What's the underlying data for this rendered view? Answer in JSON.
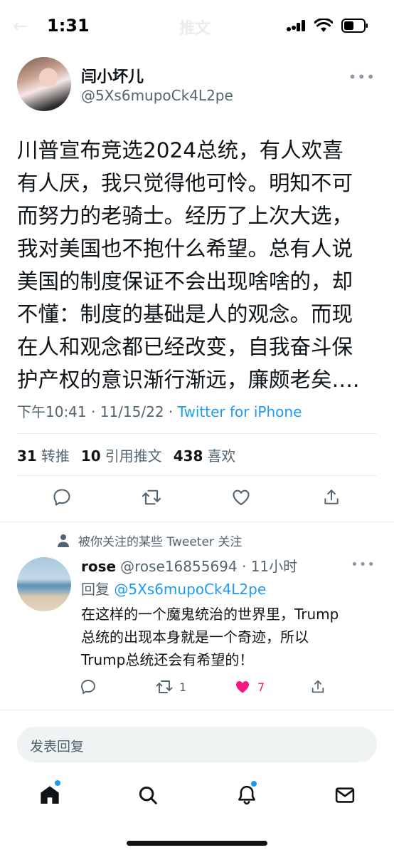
{
  "status_bar": {
    "time": "1:31"
  },
  "ghost_header": {
    "title": "推文"
  },
  "tweet": {
    "author_name": "闫小坏儿",
    "author_handle": "@5Xs6mupoCk4L2pe",
    "text": "川普宣布竞选2024总统，有人欢喜\n有人厌，我只觉得他可怜。明知不可\n而努力的老骑士。经历了上次大选，\n我对美国也不抱什么希望。总有人说\n美国的制度保证不会出现啥啥的，却\n不懂：制度的基础是人的观念。而现\n在人和观念都已经改变，自我奋斗保\n护产权的意识渐行渐远，廉颇老矣….",
    "time": "下午10:41",
    "date": "11/15/22",
    "separator": "·",
    "source": "Twitter for iPhone",
    "stats": {
      "retweets_count": "31",
      "retweets_label": "转推",
      "quotes_count": "10",
      "quotes_label": "引用推文",
      "likes_count": "438",
      "likes_label": "喜欢"
    }
  },
  "reply": {
    "context": "被你关注的某些 Tweeter 关注",
    "name": "rose",
    "handle": "@rose16855694",
    "separator": "·",
    "time": "11小时",
    "replying_label": "回复",
    "replying_to": "@5Xs6mupoCk4L2pe",
    "text": "在这样的一个魔鬼统治的世界里，Trump\n总统的出现本身就是一个奇迹，所以\nTrump总统还会有希望的！",
    "retweet_count": "1",
    "like_count": "7",
    "like_color": "#f91880"
  },
  "composer": {
    "placeholder": "发表回复"
  },
  "colors": {
    "accent": "#1d9bf0",
    "secondary_text": "#536471",
    "primary_text": "#0f1419"
  },
  "icons": [
    "home-icon",
    "search-icon",
    "bell-icon",
    "mail-icon",
    "reply-icon",
    "retweet-icon",
    "heart-icon",
    "share-icon",
    "more-icon",
    "person-icon"
  ]
}
